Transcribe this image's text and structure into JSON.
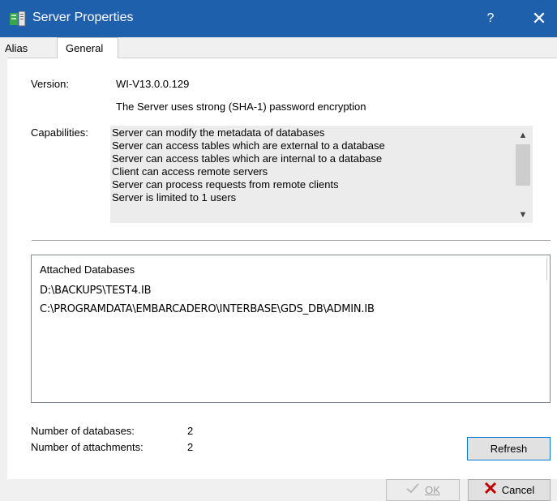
{
  "window": {
    "title": "Server Properties",
    "help_label": "?",
    "close_label": "✕"
  },
  "tabs": [
    {
      "label": "Alias",
      "active": false
    },
    {
      "label": "General",
      "active": true
    }
  ],
  "general": {
    "version_label": "Version:",
    "version_value": "WI-V13.0.0.129",
    "encryption_note": "The Server uses strong (SHA-1) password encryption",
    "capabilities_label": "Capabilities:",
    "capabilities": [
      "Server can modify the metadata of databases",
      "Server can access tables which are external to a database",
      "Server can access tables which are internal to a database",
      "Client can access remote servers",
      "Server can process requests from remote clients",
      "Server is limited to 1 users"
    ],
    "attached_header": "Attached Databases",
    "attached_databases": [
      "D:\\BACKUPS\\TEST4.IB",
      "C:\\PROGRAMDATA\\EMBARCADERO\\INTERBASE\\GDS_DB\\ADMIN.IB"
    ],
    "num_databases_label": "Number of databases:",
    "num_databases_value": "2",
    "num_attachments_label": "Number of attachments:",
    "num_attachments_value": "2",
    "refresh_label": "Refresh"
  },
  "footer": {
    "ok_label": "OK",
    "cancel_label": "Cancel"
  },
  "colors": {
    "titlebar": "#1f60ac",
    "accent_border": "#0078d7",
    "cancel_icon": "#c00000",
    "app_icon_green": "#3aa64a"
  }
}
